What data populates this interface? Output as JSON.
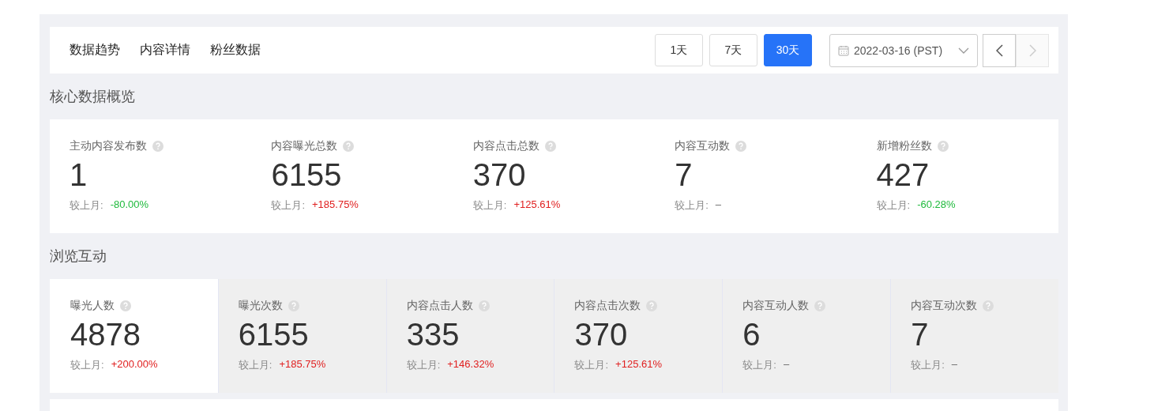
{
  "nav_tabs": [
    "数据趋势",
    "内容详情",
    "粉丝数据"
  ],
  "periods": [
    {
      "label": "1天",
      "selected": false
    },
    {
      "label": "7天",
      "selected": false
    },
    {
      "label": "30天",
      "selected": true
    }
  ],
  "date_picker": {
    "value": "2022-03-16 (PST)"
  },
  "pager": {
    "prev_disabled": false,
    "next_disabled": true
  },
  "core_overview": {
    "title": "核心数据概览",
    "metrics": [
      {
        "label": "主动内容发布数",
        "value": "1",
        "compare_label": "较上月:",
        "change": "-80.00%",
        "color": "#1fba3c"
      },
      {
        "label": "内容曝光总数",
        "value": "6155",
        "compare_label": "较上月:",
        "change": "+185.75%",
        "color": "#e02020"
      },
      {
        "label": "内容点击总数",
        "value": "370",
        "compare_label": "较上月:",
        "change": "+125.61%",
        "color": "#e02020"
      },
      {
        "label": "内容互动数",
        "value": "7",
        "compare_label": "较上月:",
        "change": "–"
      },
      {
        "label": "新增粉丝数",
        "value": "427",
        "compare_label": "较上月:",
        "change": "-60.28%",
        "color": "#1fba3c"
      }
    ]
  },
  "browse_interaction": {
    "title": "浏览互动",
    "metrics": [
      {
        "label": "曝光人数",
        "value": "4878",
        "compare_label": "较上月:",
        "change": "+200.00%",
        "color": "#e02020",
        "selected": true
      },
      {
        "label": "曝光次数",
        "value": "6155",
        "compare_label": "较上月:",
        "change": "+185.75%",
        "color": "#e02020",
        "selected": false
      },
      {
        "label": "内容点击人数",
        "value": "335",
        "compare_label": "较上月:",
        "change": "+146.32%",
        "color": "#e02020",
        "selected": false
      },
      {
        "label": "内容点击次数",
        "value": "370",
        "compare_label": "较上月:",
        "change": "+125.61%",
        "color": "#e02020",
        "selected": false
      },
      {
        "label": "内容互动人数",
        "value": "6",
        "compare_label": "较上月:",
        "change": "–",
        "selected": false
      },
      {
        "label": "内容互动次数",
        "value": "7",
        "compare_label": "较上月:",
        "change": "–",
        "selected": false
      }
    ]
  }
}
